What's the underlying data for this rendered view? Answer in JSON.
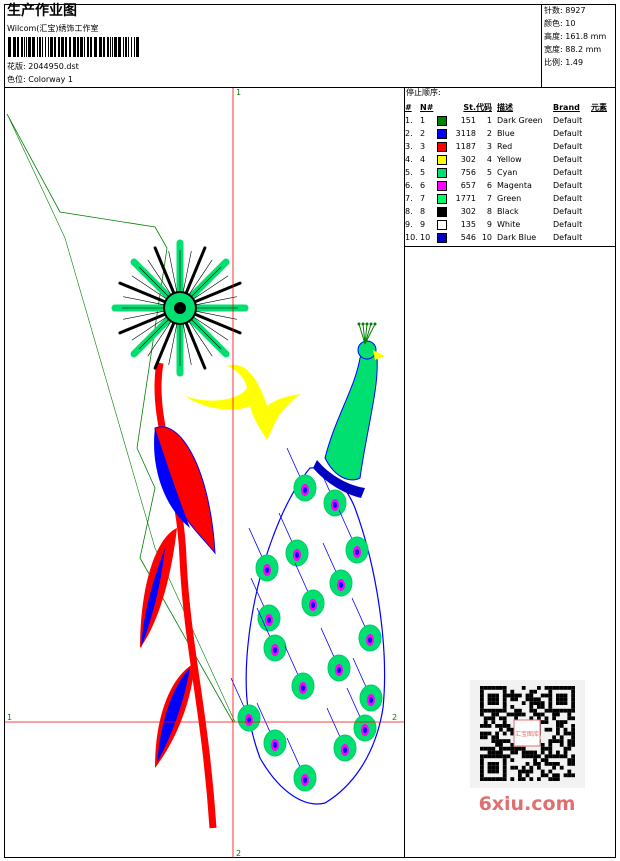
{
  "header": {
    "title": "生产作业图",
    "subtitle": "Wilcom(汇宝)绣饰工作室",
    "file_label": "花版:",
    "file_value": "2044950.dst",
    "colorway_label": "色位:",
    "colorway_value": "Colorway 1"
  },
  "info": {
    "stitches": "针数: 8927",
    "colors": "颜色: 10",
    "height": "高度: 161.8 mm",
    "width": "宽度: 88.2 mm",
    "ratio": "比例: 1.49"
  },
  "stop_sequence": {
    "label": "停止顺序:",
    "headers": [
      "#",
      "N#",
      "St.",
      "代码",
      "描述",
      "Brand",
      "元素"
    ],
    "rows": [
      {
        "idx": "1.",
        "n": "1",
        "color": "#008000",
        "st": "151",
        "code": "1",
        "desc": "Dark Green",
        "brand": "Default"
      },
      {
        "idx": "2.",
        "n": "2",
        "color": "#0000ff",
        "st": "3118",
        "code": "2",
        "desc": "Blue",
        "brand": "Default"
      },
      {
        "idx": "3.",
        "n": "3",
        "color": "#ff0000",
        "st": "1187",
        "code": "3",
        "desc": "Red",
        "brand": "Default"
      },
      {
        "idx": "4.",
        "n": "4",
        "color": "#ffff00",
        "st": "302",
        "code": "4",
        "desc": "Yellow",
        "brand": "Default"
      },
      {
        "idx": "5.",
        "n": "5",
        "color": "#00e070",
        "st": "756",
        "code": "5",
        "desc": "Cyan",
        "brand": "Default"
      },
      {
        "idx": "6.",
        "n": "6",
        "color": "#ff00ff",
        "st": "657",
        "code": "6",
        "desc": "Magenta",
        "brand": "Default"
      },
      {
        "idx": "7.",
        "n": "7",
        "color": "#00ff66",
        "st": "1771",
        "code": "7",
        "desc": "Green",
        "brand": "Default"
      },
      {
        "idx": "8.",
        "n": "8",
        "color": "#000000",
        "st": "302",
        "code": "8",
        "desc": "Black",
        "brand": "Default"
      },
      {
        "idx": "9.",
        "n": "9",
        "color": "#ffffff",
        "st": "135",
        "code": "9",
        "desc": "White",
        "brand": "Default"
      },
      {
        "idx": "10.",
        "n": "10",
        "color": "#0000c0",
        "st": "546",
        "code": "10",
        "desc": "Dark Blue",
        "brand": "Default"
      }
    ]
  },
  "axes": {
    "top": "1",
    "bottom": "2",
    "left": "1",
    "right": "2"
  },
  "watermark": {
    "text": "6xiu.com",
    "qr_label": "汇宝图库",
    "accent": "#e07070"
  }
}
